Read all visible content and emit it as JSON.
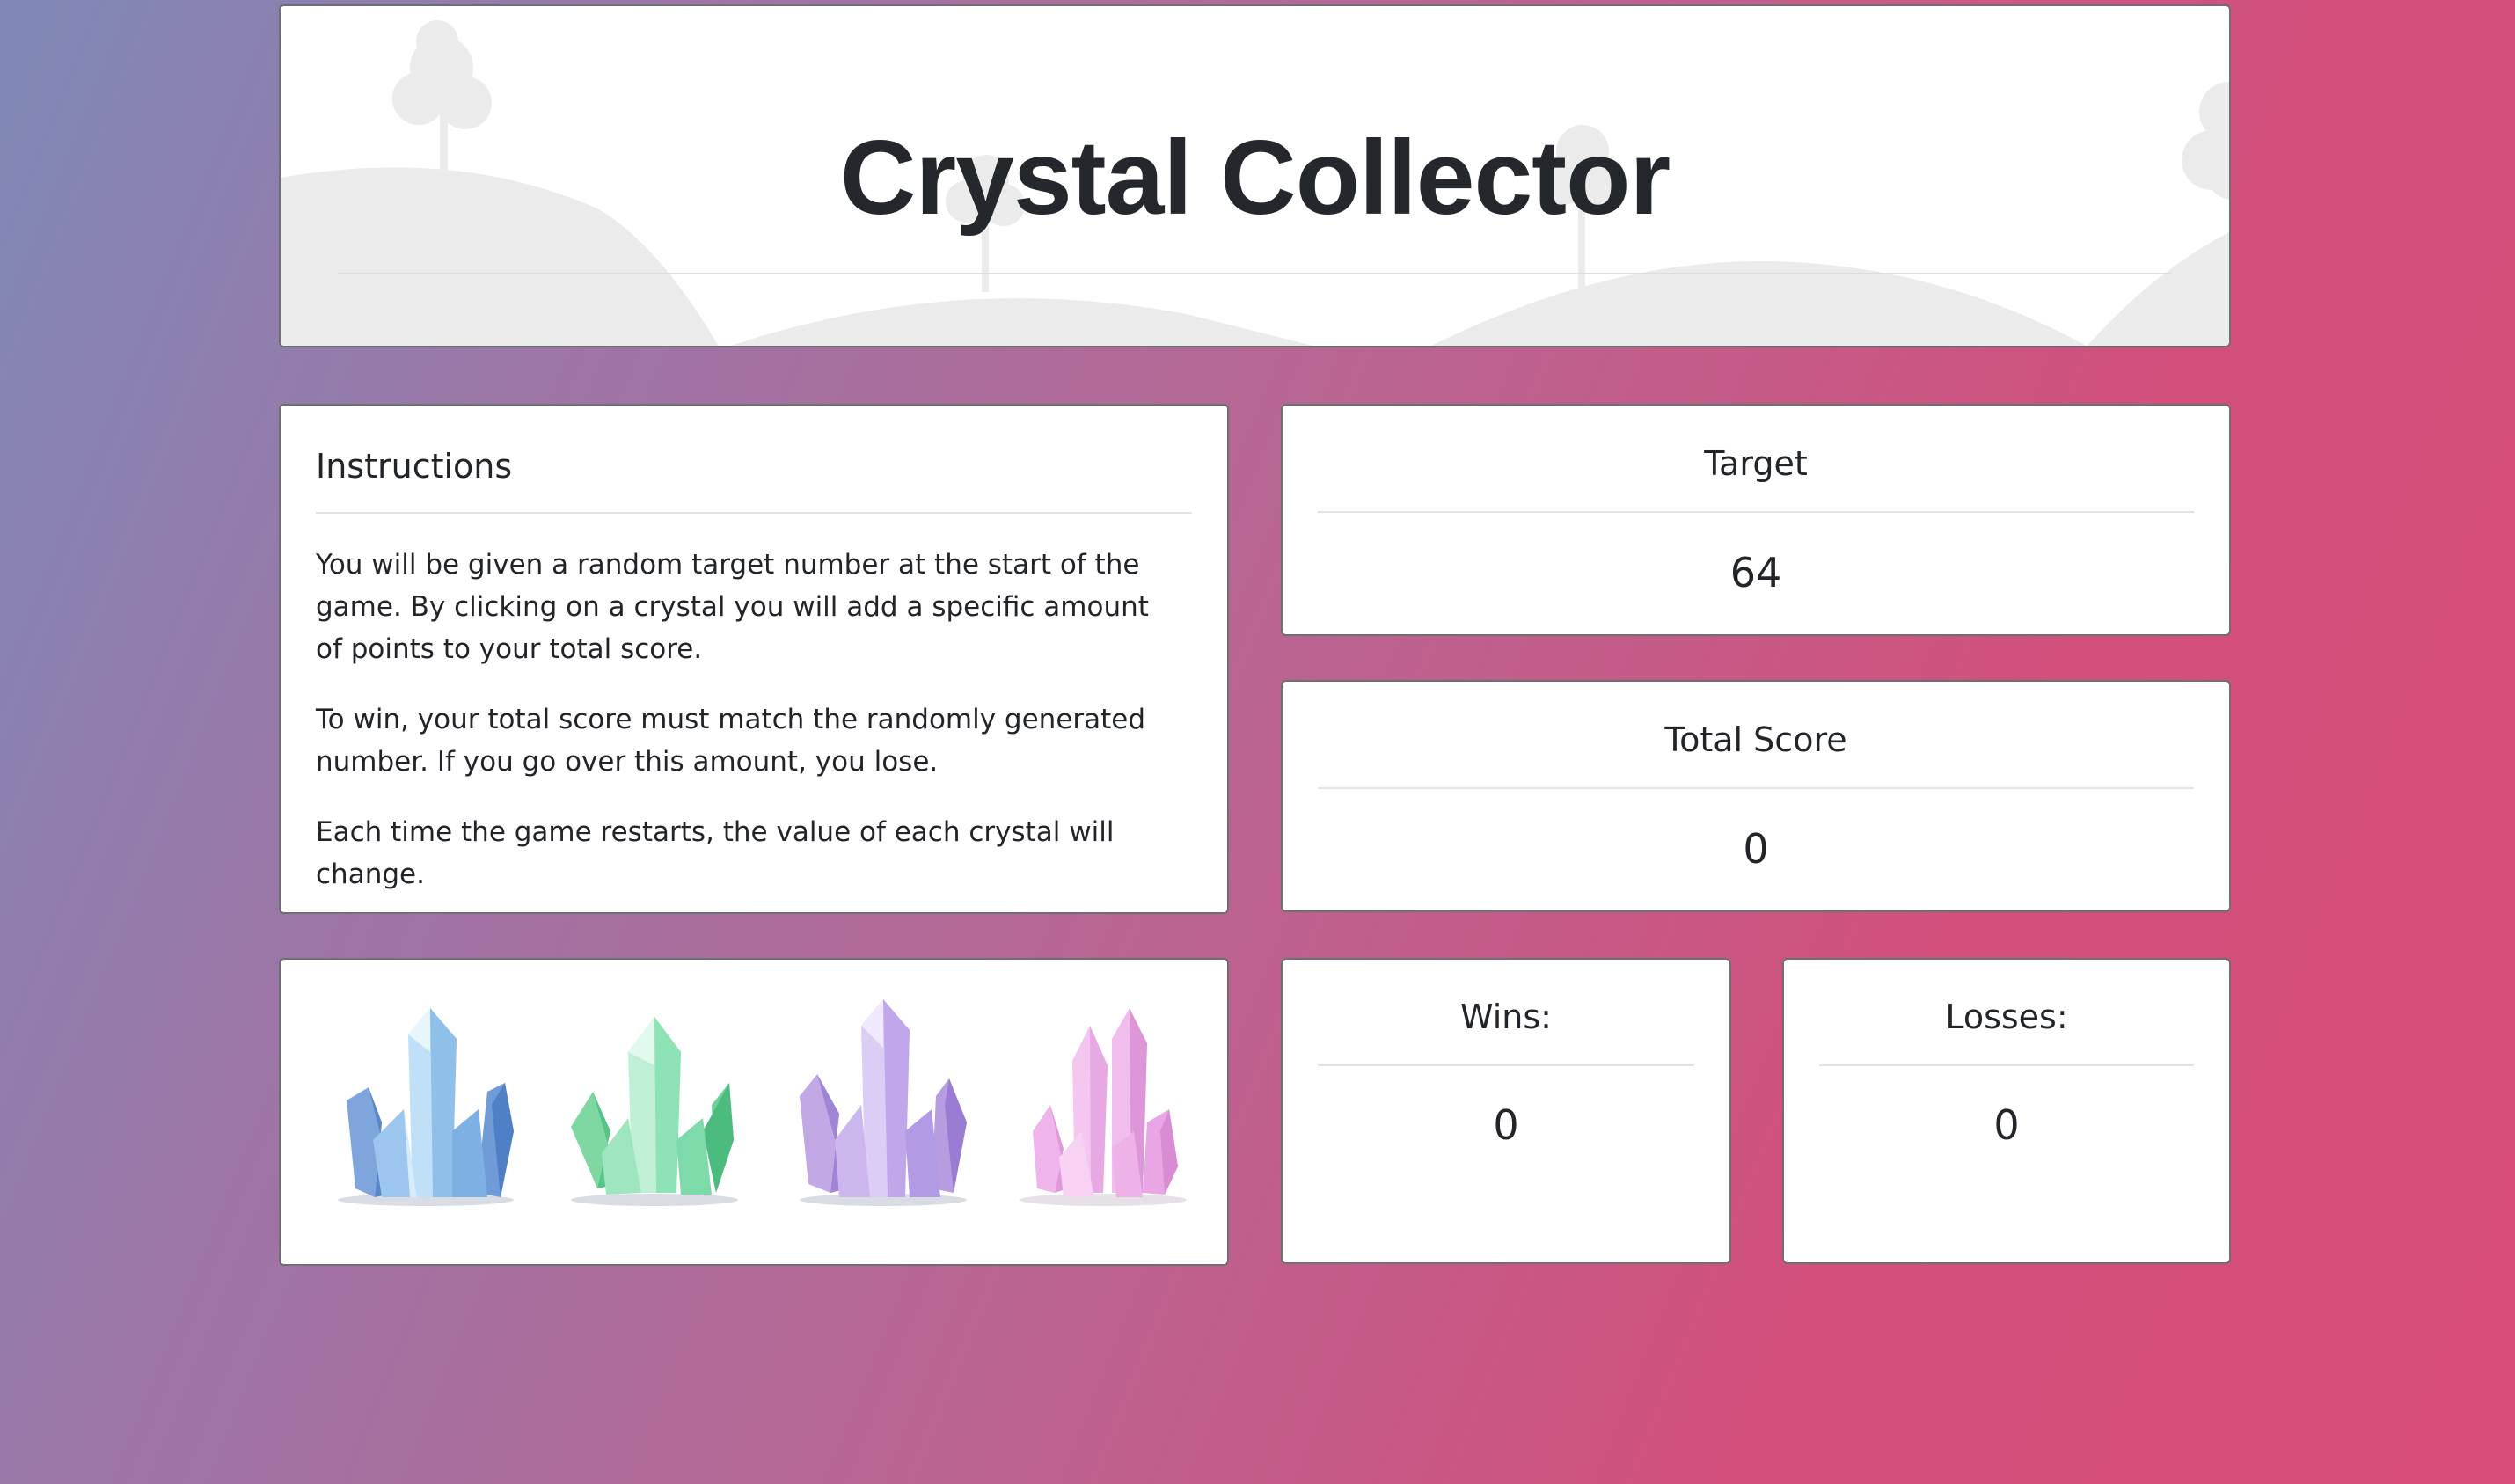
{
  "header": {
    "title": "Crystal Collector"
  },
  "instructions": {
    "heading": "Instructions",
    "paragraphs": [
      "You will be given a random target number at the start of the game. By clicking on a crystal you will add a specific amount of points to your total score.",
      "To win, your total score must match the randomly generated number. If you go over this amount, you lose.",
      "Each time the game restarts, the value of each crystal will change."
    ]
  },
  "target": {
    "label": "Target",
    "value": "64"
  },
  "score": {
    "label": "Total Score",
    "value": "0"
  },
  "wins": {
    "label": "Wins:",
    "value": "0"
  },
  "losses": {
    "label": "Losses:",
    "value": "0"
  },
  "crystals": [
    {
      "name": "blue-crystal",
      "color": "#7ea7dc"
    },
    {
      "name": "green-crystal",
      "color": "#7fd9a8"
    },
    {
      "name": "purple-crystal",
      "color": "#b79ce0"
    },
    {
      "name": "pink-crystal",
      "color": "#e6a2e0"
    }
  ]
}
